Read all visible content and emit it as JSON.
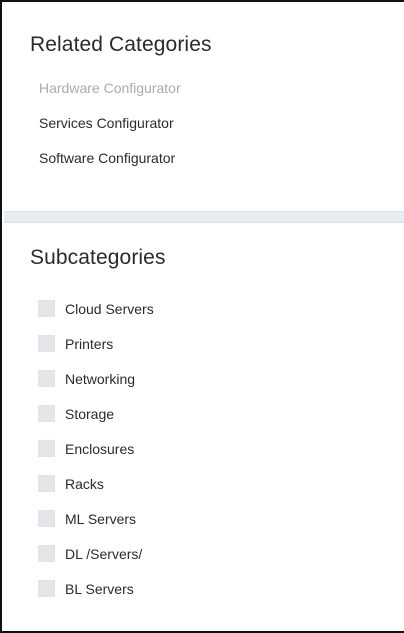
{
  "related": {
    "title": "Related Categories",
    "items": [
      {
        "label": "Hardware Configurator",
        "muted": true
      },
      {
        "label": "Services Configurator",
        "muted": false
      },
      {
        "label": "Software Configurator",
        "muted": false
      }
    ]
  },
  "subcategories": {
    "title": "Subcategories",
    "items": [
      {
        "label": "Cloud Servers",
        "checked": false
      },
      {
        "label": "Printers",
        "checked": false
      },
      {
        "label": "Networking",
        "checked": false
      },
      {
        "label": "Storage",
        "checked": false
      },
      {
        "label": "Enclosures",
        "checked": false
      },
      {
        "label": "Racks",
        "checked": false
      },
      {
        "label": "ML Servers",
        "checked": false
      },
      {
        "label": "DL /Servers/",
        "checked": false
      },
      {
        "label": "BL Servers",
        "checked": false
      }
    ]
  },
  "colors": {
    "muted_link": "#a7acb2",
    "text": "#2b2b2b",
    "checkbox_fill": "#e4e6ea",
    "divider": "#e9edf1"
  }
}
